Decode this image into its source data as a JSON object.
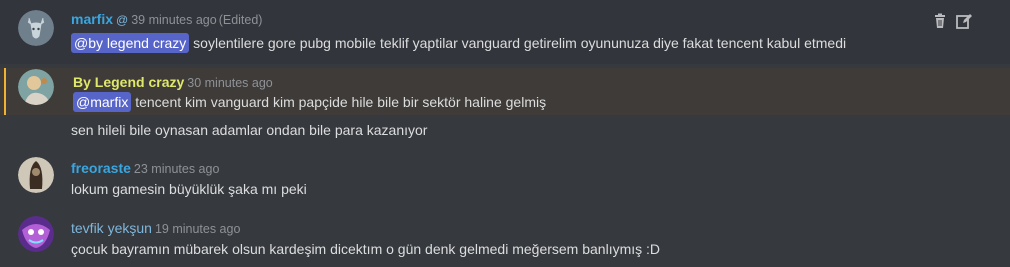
{
  "messages": [
    {
      "author": "marfix",
      "mention_icon": "@",
      "timestamp": "39 minutes ago",
      "edited": "(Edited)",
      "mention": "@by legend crazy",
      "text": " soylentilere gore pubg mobile teklif yaptilar vanguard getirelim oyununuza diye fakat tencent kabul etmedi",
      "actions": [
        "trash-icon",
        "edit-icon"
      ]
    },
    {
      "author": "By Legend crazy",
      "timestamp": "30 minutes ago",
      "mention": "@marfix",
      "text": " tencent kim vanguard kim papçide hile bile bir sektör haline gelmiş",
      "continuation": "sen hileli bile oynasan adamlar ondan bile para kazanıyor"
    },
    {
      "author": "freoraste",
      "timestamp": "23 minutes ago",
      "text": "lokum gamesin büyüklük şaka mı peki"
    },
    {
      "author": "tevfik yekşun",
      "timestamp": "19 minutes ago",
      "text": "çocuk bayramın mübarek olsun kardeşim dicektım o gün denk gelmedi meğersem banlıymış :D"
    }
  ],
  "colors": {
    "background": "#36393e",
    "mention_bg": "#5865c8",
    "highlight_bar": "#f0b232"
  }
}
